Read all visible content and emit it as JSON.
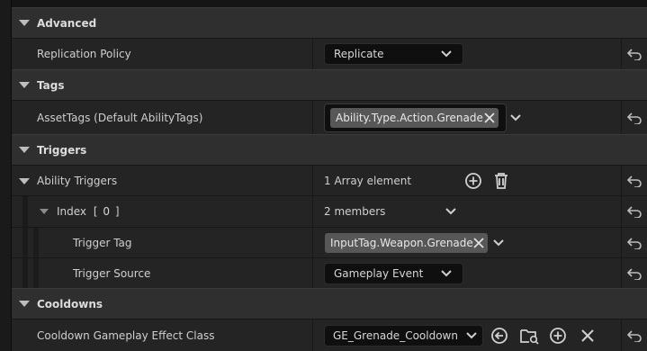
{
  "categories": {
    "advanced": "Advanced",
    "tags": "Tags",
    "triggers": "Triggers",
    "cooldowns": "Cooldowns"
  },
  "properties": {
    "replication_policy": {
      "label": "Replication Policy",
      "value": "Replicate"
    },
    "asset_tags": {
      "label": "AssetTags (Default AbilityTags)",
      "tag": "Ability.Type.Action.Grenade"
    },
    "ability_triggers": {
      "label": "Ability Triggers",
      "value": "1 Array element"
    },
    "index": {
      "label": "Index",
      "bracket_open": "[",
      "number": "0",
      "bracket_close": "]",
      "value": "2 members"
    },
    "trigger_tag": {
      "label": "Trigger Tag",
      "tag": "InputTag.Weapon.Grenade"
    },
    "trigger_source": {
      "label": "Trigger Source",
      "value": "Gameplay Event"
    },
    "cooldown_class": {
      "label": "Cooldown Gameplay Effect Class",
      "value": "GE_Grenade_Cooldown"
    }
  },
  "icons": {
    "reset": "reset-arrow-icon",
    "add": "plus-circle-icon",
    "delete": "trash-icon",
    "use_selected": "arrow-left-circle-icon",
    "browse": "folder-search-icon",
    "clear": "x-icon",
    "chevron": "chevron-down-icon"
  }
}
